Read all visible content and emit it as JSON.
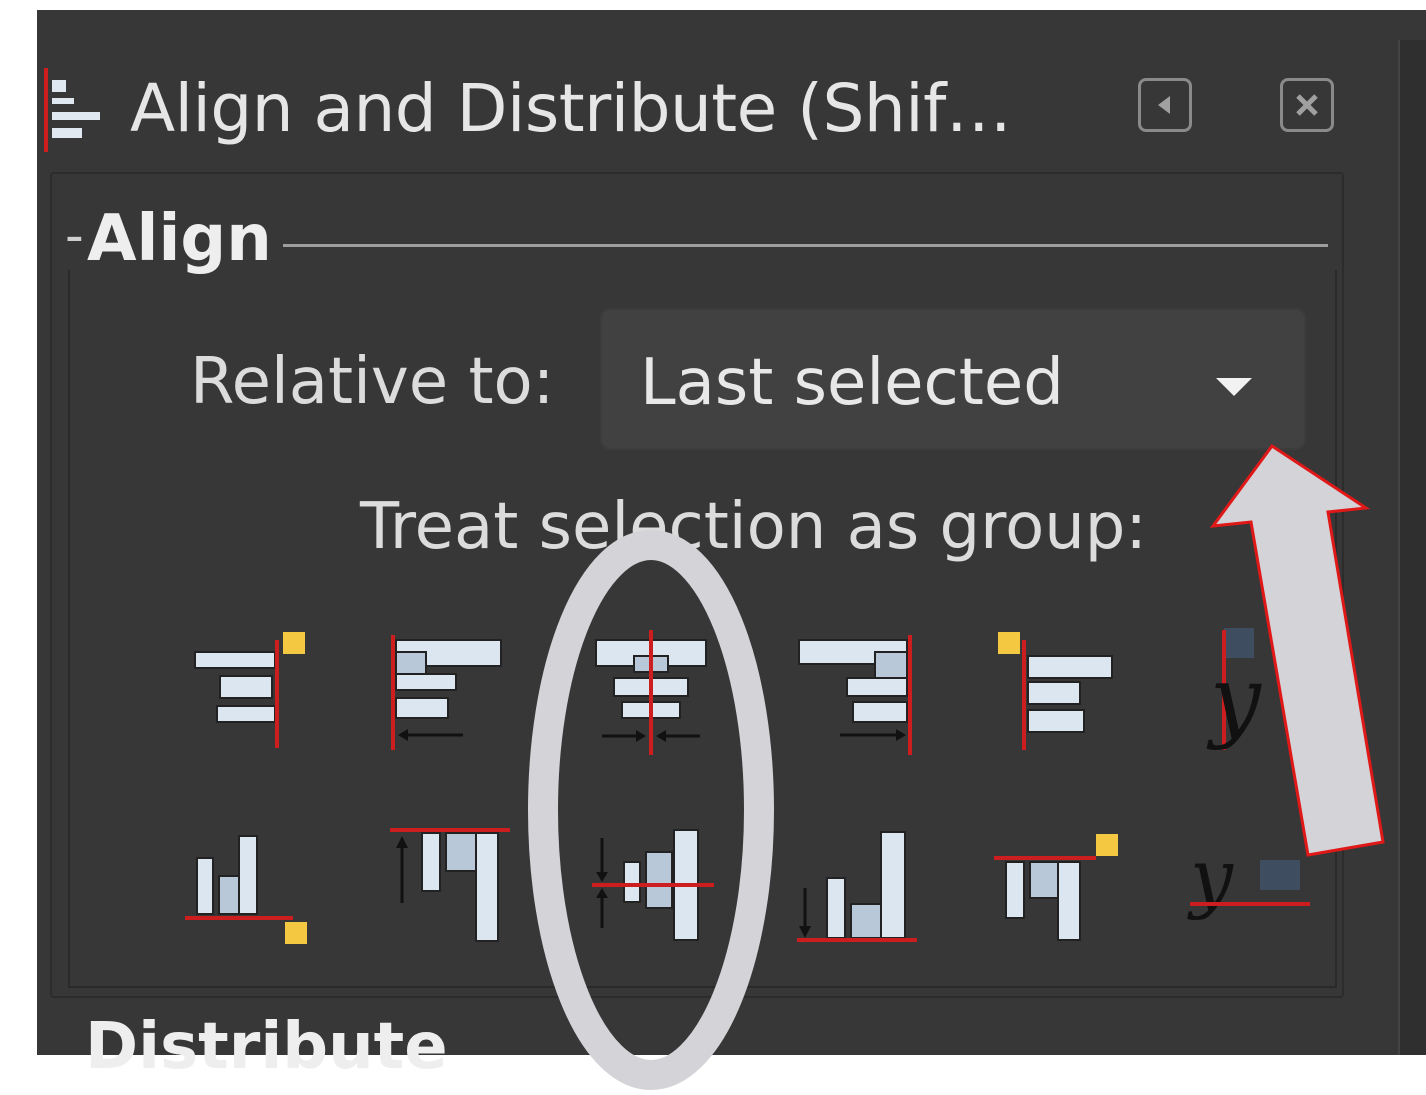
{
  "dialog": {
    "title": "Align and Distribute (Shif…",
    "title_icon": "align-distribute-icon",
    "buttons": [
      {
        "name": "iconify-button",
        "icon": "arrow-left-box-icon"
      },
      {
        "name": "close-button",
        "icon": "close-box-icon"
      }
    ]
  },
  "align": {
    "section_label": "Align",
    "relative_to_label": "Relative to:",
    "relative_to_value": "Last selected",
    "treat_as_group_label": "Treat selection as group:",
    "icons_row1": [
      "align-right-edges-to-left-anchor-icon",
      "align-left-edges-icon",
      "center-on-vertical-axis-icon",
      "align-right-edges-icon",
      "align-left-edges-to-right-anchor-icon",
      "align-baselines-horizontal-icon"
    ],
    "icons_row2": [
      "align-bottom-edges-to-top-anchor-icon",
      "align-top-edges-icon",
      "center-on-horizontal-axis-icon",
      "align-bottom-edges-icon",
      "align-top-edges-to-bottom-anchor-icon",
      "align-baselines-vertical-icon"
    ]
  },
  "distribute": {
    "section_label": "Distribute"
  },
  "colors": {
    "panel_bg": "#373737",
    "text": "#dcdcdc",
    "guide_red": "#cc1e1e",
    "anchor_yellow": "#f5c842",
    "annotation_gray": "#d3d3d8",
    "annotation_red_outline": "#e01818"
  },
  "annotations": {
    "ellipse": "highlight-center-on-axis-icons",
    "arrow": "points-to-relative-to-dropdown"
  }
}
